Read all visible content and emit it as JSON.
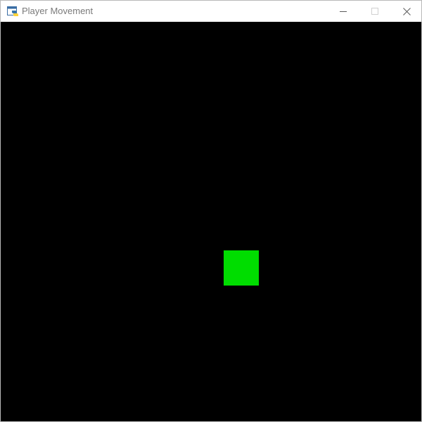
{
  "window": {
    "title": "Player Movement",
    "icons": {
      "app": "python-window-icon",
      "minimize": "minimize-icon",
      "maximize": "maximize-icon",
      "close": "close-icon"
    }
  },
  "game": {
    "background_color": "#000000",
    "player": {
      "color": "#00dd00"
    }
  }
}
